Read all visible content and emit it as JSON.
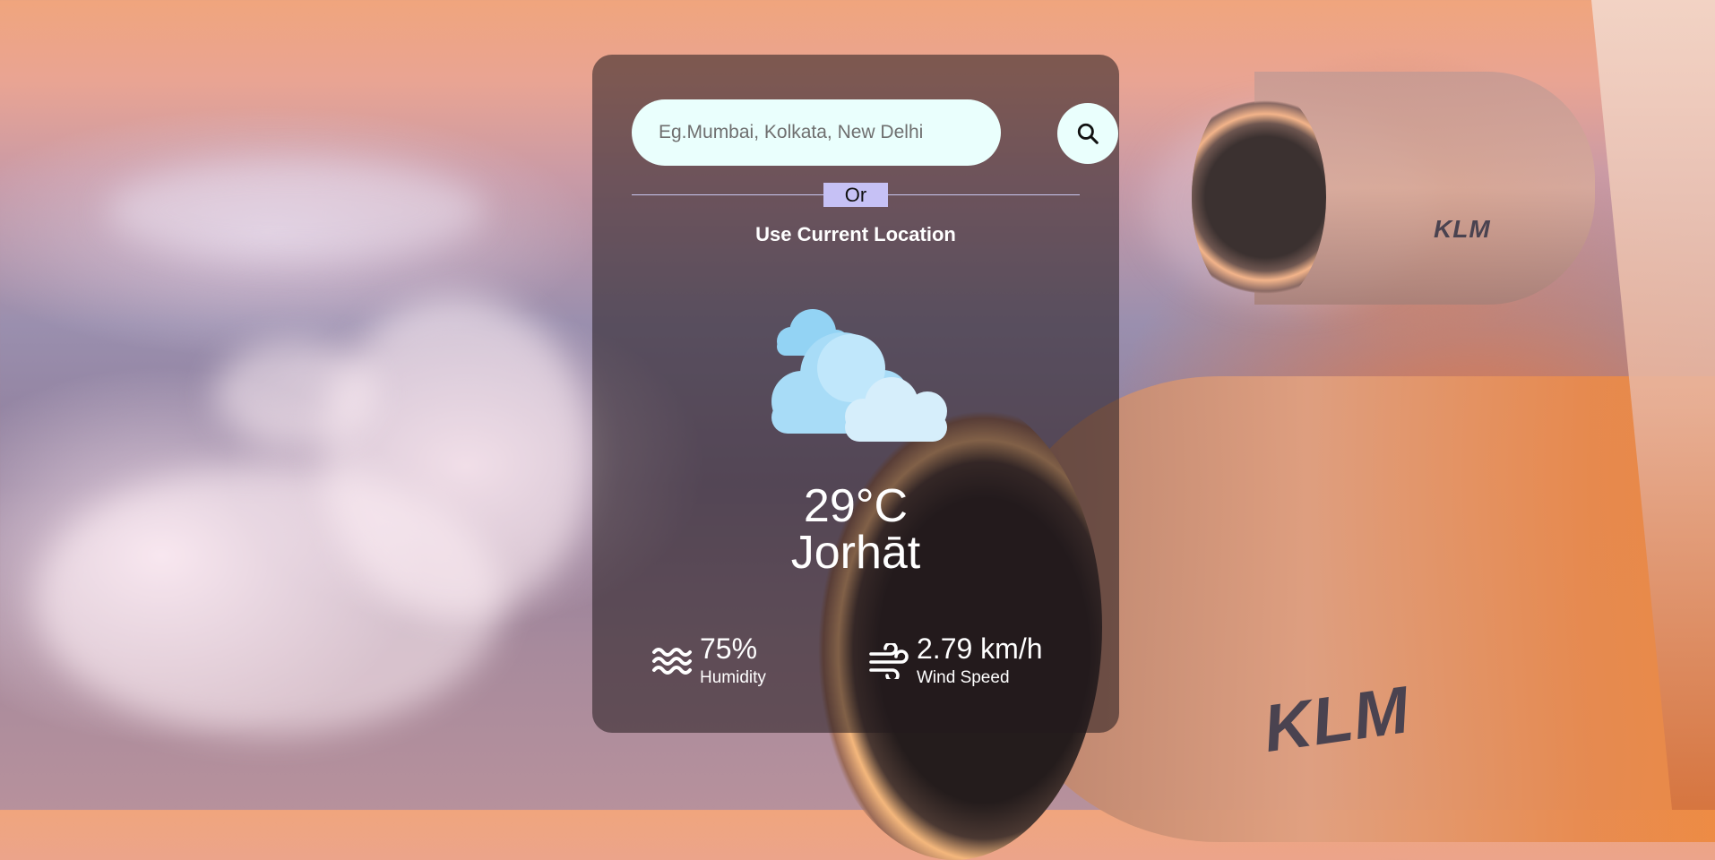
{
  "search": {
    "placeholder": "Eg.Mumbai, Kolkata, New Delhi",
    "button_icon": "search-icon"
  },
  "divider": {
    "label": "Or"
  },
  "location": {
    "label": "Use Current Location"
  },
  "weather": {
    "icon": "cloudy-icon",
    "temperature": "29°C",
    "city": "Jorhāt"
  },
  "stats": {
    "humidity": {
      "icon": "waves-icon",
      "value": "75%",
      "label": "Humidity"
    },
    "wind": {
      "icon": "wind-icon",
      "value": "2.79 km/h",
      "label": "Wind Speed"
    }
  },
  "background": {
    "brand_small": "KLM",
    "brand_large": "KLM"
  },
  "colors": {
    "card_bg": "rgba(35,25,30,0.55)",
    "input_bg": "#eafffd",
    "or_badge_bg": "#c6c1f5",
    "text": "#ffffff",
    "cloud_light": "#bfe6fb",
    "cloud_mid": "#93d3f4"
  }
}
